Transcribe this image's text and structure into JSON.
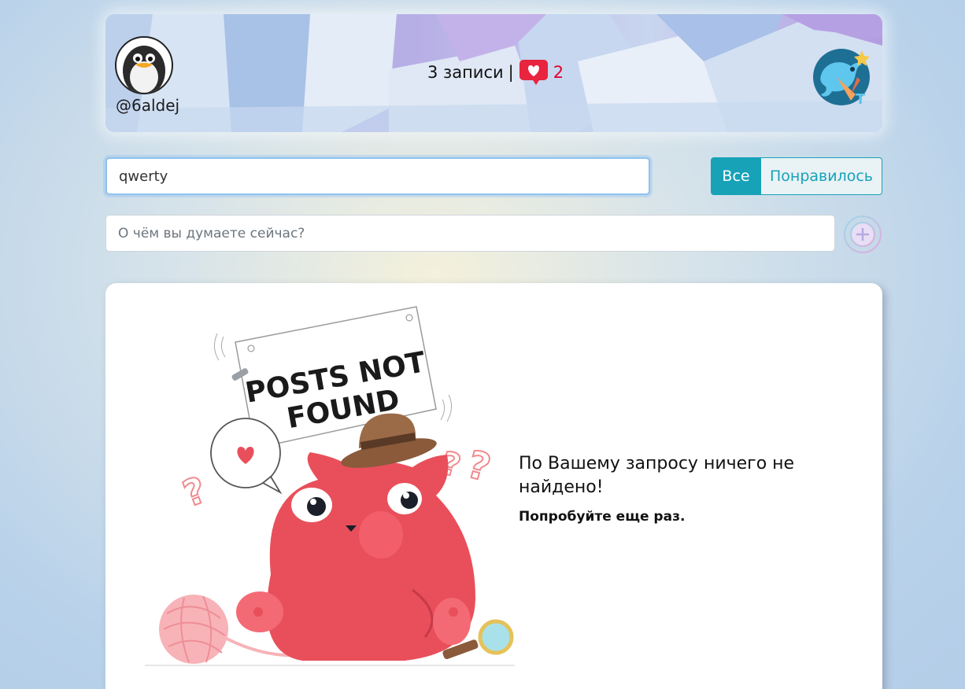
{
  "header": {
    "username": "@6aldej",
    "posts_count": "3 записи",
    "separator": "|",
    "likes_count": "2"
  },
  "search": {
    "value": "qwerty"
  },
  "filter": {
    "all_label": "Все",
    "liked_label": "Понравилось",
    "selected": "Все"
  },
  "new_post": {
    "placeholder": "О чём вы думаете сейчас?"
  },
  "empty_state": {
    "sign_line1": "POSTS NOT",
    "sign_line2": "FOUND",
    "title": "По Вашему запросу ничего не найдено!",
    "subtitle": "Попробуйте еще раз."
  },
  "icons": {
    "avatar": "penguin-icon",
    "likes": "heart-icon",
    "logo": "bird-logo-icon",
    "add": "plus-circle-icon"
  },
  "colors": {
    "accent": "#17a2b8",
    "likes": "#e4002b",
    "cat": "#e94f5b"
  }
}
